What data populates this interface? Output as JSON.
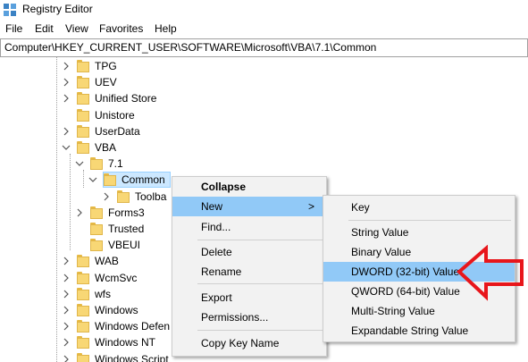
{
  "window": {
    "title": "Registry Editor",
    "icon": "registry-editor-icon"
  },
  "menu": [
    "File",
    "Edit",
    "View",
    "Favorites",
    "Help"
  ],
  "address": "Computer\\HKEY_CURRENT_USER\\SOFTWARE\\Microsoft\\VBA\\7.1\\Common",
  "tree": [
    {
      "label": "TPG",
      "chevron": "right"
    },
    {
      "label": "UEV",
      "chevron": "right"
    },
    {
      "label": "Unified Store",
      "chevron": "right"
    },
    {
      "label": "Unistore",
      "chevron": "none"
    },
    {
      "label": "UserData",
      "chevron": "right"
    },
    {
      "label": "VBA",
      "chevron": "down"
    },
    {
      "label": "7.1",
      "chevron": "down"
    },
    {
      "label": "Common",
      "chevron": "down",
      "selected": true
    },
    {
      "label": "Toolba",
      "chevron": "right"
    },
    {
      "label": "Forms3",
      "chevron": "right"
    },
    {
      "label": "Trusted",
      "chevron": "none"
    },
    {
      "label": "VBEUI",
      "chevron": "none"
    },
    {
      "label": "WAB",
      "chevron": "right"
    },
    {
      "label": "WcmSvc",
      "chevron": "right"
    },
    {
      "label": "wfs",
      "chevron": "right"
    },
    {
      "label": "Windows",
      "chevron": "right"
    },
    {
      "label": "Windows Defen",
      "chevron": "right"
    },
    {
      "label": "Windows NT",
      "chevron": "right"
    },
    {
      "label": "Windows Script",
      "chevron": "right"
    }
  ],
  "context_menu": {
    "collapse": "Collapse",
    "new": "New",
    "new_arrow": ">",
    "find": "Find...",
    "delete": "Delete",
    "rename": "Rename",
    "export": "Export",
    "permissions": "Permissions...",
    "copy_key_name": "Copy Key Name"
  },
  "new_submenu": {
    "key": "Key",
    "string_value": "String Value",
    "binary_value": "Binary Value",
    "dword_value": "DWORD (32-bit) Value",
    "qword_value": "QWORD (64-bit) Value",
    "multi_string_value": "Multi-String Value",
    "expandable_string_value": "Expandable String Value"
  },
  "colors": {
    "highlight": "#91c9f7",
    "selection": "#cce8ff",
    "folder": "#f8d775",
    "annotation_arrow": "#e8161b"
  }
}
